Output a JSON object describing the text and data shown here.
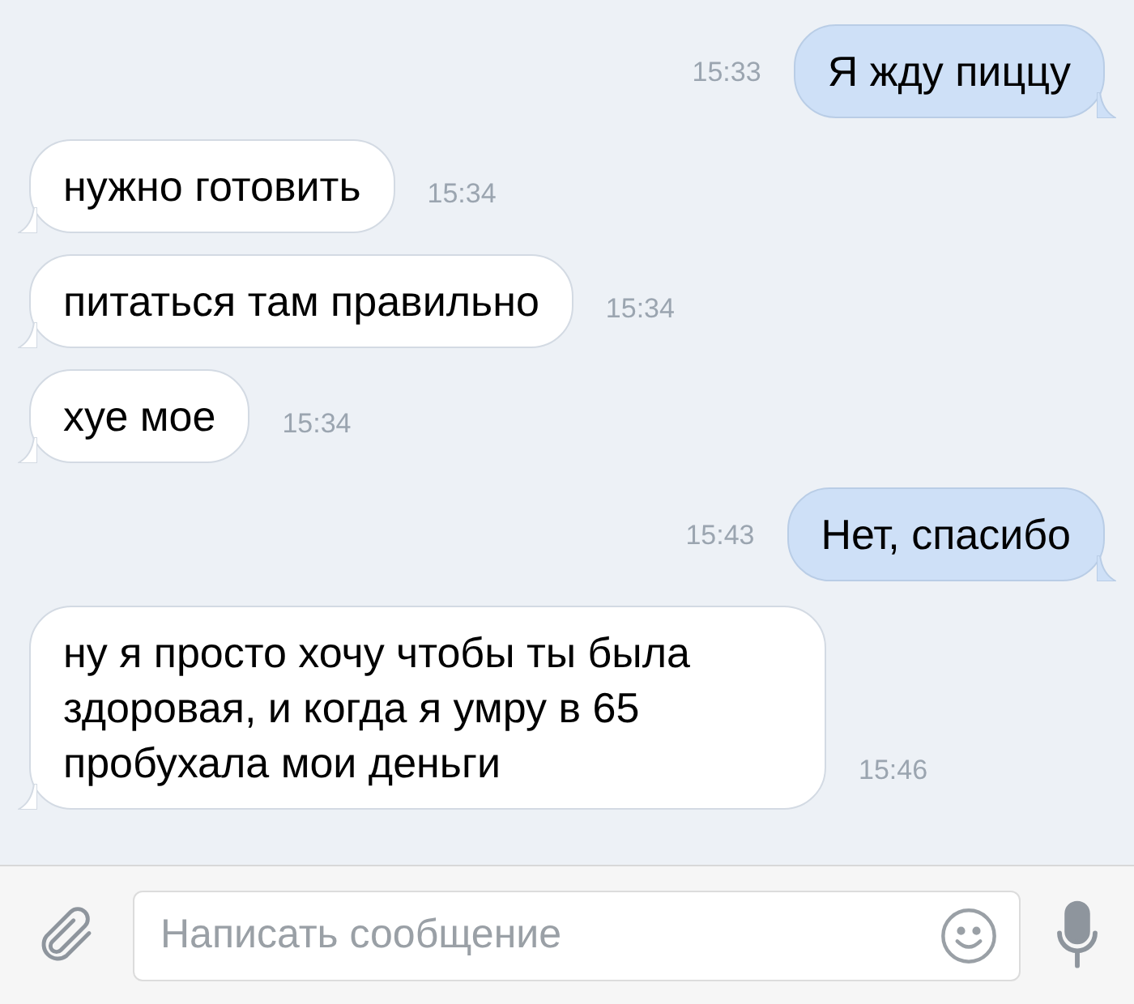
{
  "messages": [
    {
      "kind": "out",
      "text": "Я жду пиццу",
      "time": "15:33"
    },
    {
      "kind": "in",
      "text": "нужно готовить",
      "time": "15:34"
    },
    {
      "kind": "in",
      "text": "питаться там правильно",
      "time": "15:34"
    },
    {
      "kind": "in",
      "text": "хуе мое",
      "time": "15:34"
    },
    {
      "kind": "out",
      "text": "Нет, спасибо",
      "time": "15:43"
    },
    {
      "kind": "in",
      "text": "ну я просто хочу чтобы ты была здоровая, и когда я умру в 65 пробухала мои деньги",
      "time": "15:46"
    }
  ],
  "composer": {
    "placeholder": "Написать сообщение"
  }
}
